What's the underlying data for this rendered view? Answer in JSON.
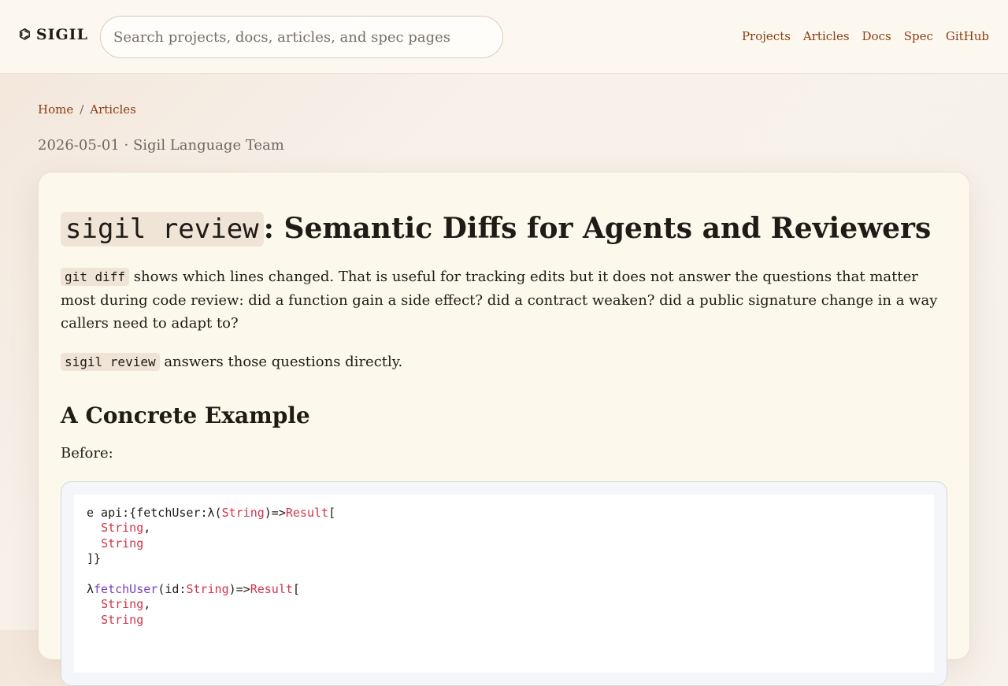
{
  "header": {
    "brand_logo": "⌬",
    "brand": "SIGIL",
    "search_placeholder": "Search projects, docs, articles, and spec pages",
    "nav": [
      "Projects",
      "Articles",
      "Docs",
      "Spec",
      "GitHub"
    ]
  },
  "breadcrumb": {
    "home": "Home",
    "separator": "/",
    "section": "Articles"
  },
  "meta": "2026-05-01 · Sigil Language Team",
  "article": {
    "title_code": "sigil review",
    "title_rest": ": Semantic Diffs for Agents and Reviewers",
    "p1_code": "git diff",
    "p1_text": " shows which lines changed. That is useful for tracking edits but it does not answer the questions that matter most during code review: did a function gain a side effect? did a contract weaken? did a public signature change in a way callers need to adapt to?",
    "p2_code": "sigil review",
    "p2_text": " answers those questions directly.",
    "h2": "A Concrete Example",
    "before_label": "Before:",
    "code": {
      "l1a": "e api:{fetchUser:λ(",
      "l1b": "String",
      "l1c": ")=>",
      "l1d": "Result",
      "l1e": "[",
      "l2": "String",
      "l2b": ",",
      "l3": "String",
      "l4": "]}",
      "l6a": "λ",
      "l6b": "fetchUser",
      "l6c": "(id:",
      "l6d": "String",
      "l6e": ")=>",
      "l6f": "Result",
      "l6g": "[",
      "l7": "String",
      "l7b": ",",
      "l8": "String"
    }
  }
}
